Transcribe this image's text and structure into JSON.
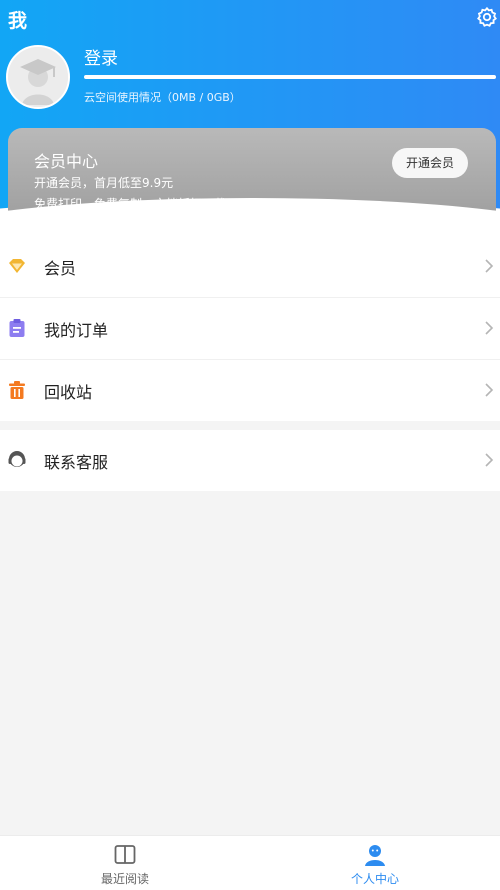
{
  "header": {
    "title": "我",
    "login_label": "登录",
    "storage_text": "云空间使用情况（0MB / 0GB）",
    "colors": {
      "gradient_start": "#12a6f5",
      "gradient_end": "#2f8af5"
    }
  },
  "vip_card": {
    "title": "会员中心",
    "desc1": "开通会员，首月低至9.9元",
    "desc2": "免费打印、免费复制、文档折扣下载",
    "button_label": "开通会员"
  },
  "menu": {
    "group1": [
      {
        "label": "会员",
        "icon": "diamond-icon",
        "color": "#f2b632"
      },
      {
        "label": "我的订单",
        "icon": "clipboard-icon",
        "color": "#8d7df0"
      },
      {
        "label": "回收站",
        "icon": "trash-icon",
        "color": "#f47a20"
      }
    ],
    "group2": [
      {
        "label": "联系客服",
        "icon": "headset-icon",
        "color": "#555555"
      }
    ]
  },
  "tabbar": {
    "tabs": [
      {
        "label": "最近阅读",
        "icon": "book-icon",
        "active": false
      },
      {
        "label": "个人中心",
        "icon": "user-icon",
        "active": true
      }
    ],
    "active_color": "#2d8cf0",
    "inactive_color": "#666666"
  }
}
